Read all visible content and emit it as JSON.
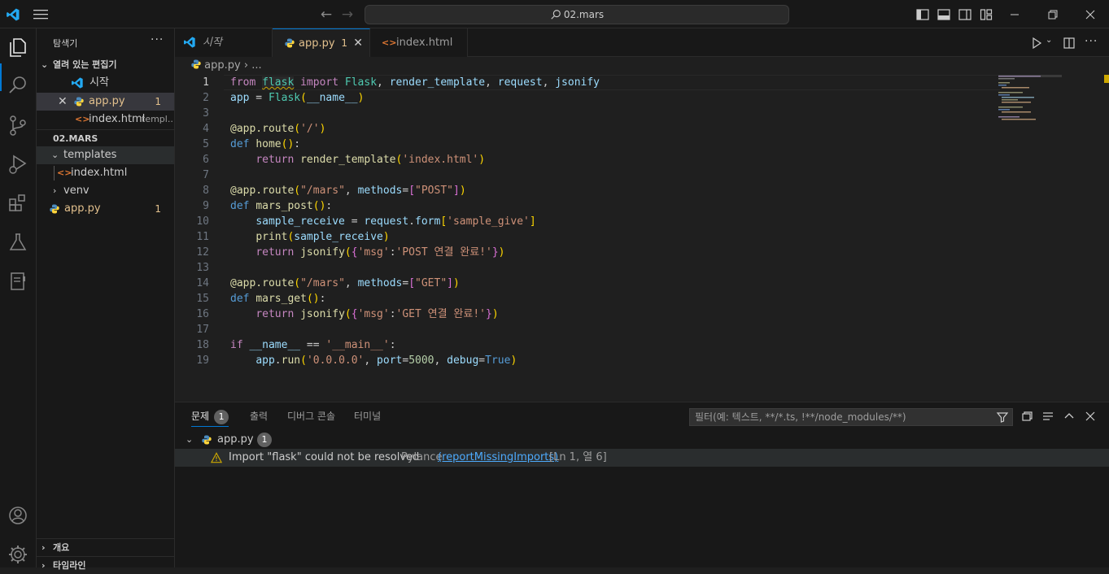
{
  "titlebar": {
    "search_text": "02.mars"
  },
  "sidebar": {
    "title": "탐색기",
    "more": "···",
    "open_editors_title": "열려 있는 편집기",
    "open_editors": [
      {
        "name": "시작",
        "type": "vscode"
      },
      {
        "name": "app.py",
        "type": "python",
        "badge": "1",
        "modified": true
      },
      {
        "name": "index.html",
        "type": "html",
        "hint": "templ..."
      }
    ],
    "folder_title": "02.MARS",
    "tree": [
      {
        "name": "templates",
        "type": "folder",
        "open": true
      },
      {
        "name": "index.html",
        "type": "html"
      },
      {
        "name": "venv",
        "type": "folder",
        "open": false
      },
      {
        "name": "app.py",
        "type": "python",
        "badge": "1"
      }
    ],
    "outline": "개요",
    "timeline": "타임라인"
  },
  "tabs": [
    {
      "label": "시작",
      "type": "vscode"
    },
    {
      "label": "app.py",
      "type": "python",
      "badge": "1",
      "active": true
    },
    {
      "label": "index.html",
      "type": "html"
    }
  ],
  "breadcrumb": {
    "file": "app.py",
    "more": "..."
  },
  "editor": {
    "line_numbers": [
      "1",
      "2",
      "3",
      "4",
      "5",
      "6",
      "7",
      "8",
      "9",
      "10",
      "11",
      "12",
      "13",
      "14",
      "15",
      "16",
      "17",
      "18",
      "19"
    ],
    "lines": [
      "from flask import Flask, render_template, request, jsonify",
      "app = Flask(__name__)",
      "",
      "@app.route('/')",
      "def home():",
      "    return render_template('index.html')",
      "",
      "@app.route(\"/mars\", methods=[\"POST\"])",
      "def mars_post():",
      "    sample_receive = request.form['sample_give']",
      "    print(sample_receive)",
      "    return jsonify({'msg':'POST 연결 완료!'})",
      "",
      "@app.route(\"/mars\", methods=[\"GET\"])",
      "def mars_get():",
      "    return jsonify({'msg':'GET 연결 완료!'})",
      "",
      "if __name__ == '__main__':",
      "    app.run('0.0.0.0', port=5000, debug=True)"
    ]
  },
  "panel": {
    "tabs": [
      {
        "label": "문제",
        "badge": "1",
        "active": true
      },
      {
        "label": "출력"
      },
      {
        "label": "디버그 콘솔"
      },
      {
        "label": "터미널"
      }
    ],
    "filter_placeholder": "필터(예: 텍스트, **/*.ts, !**/node_modules/**)",
    "file": "app.py",
    "file_count": "1",
    "problem": {
      "message": "Import \"flask\" could not be resolved",
      "source": "Pylance",
      "code": "(reportMissingImports)",
      "location": "[Ln 1, 열 6]"
    }
  },
  "colors": {
    "accent": "#0078d4",
    "warning": "#cca700",
    "modified": "#e2c08d"
  }
}
